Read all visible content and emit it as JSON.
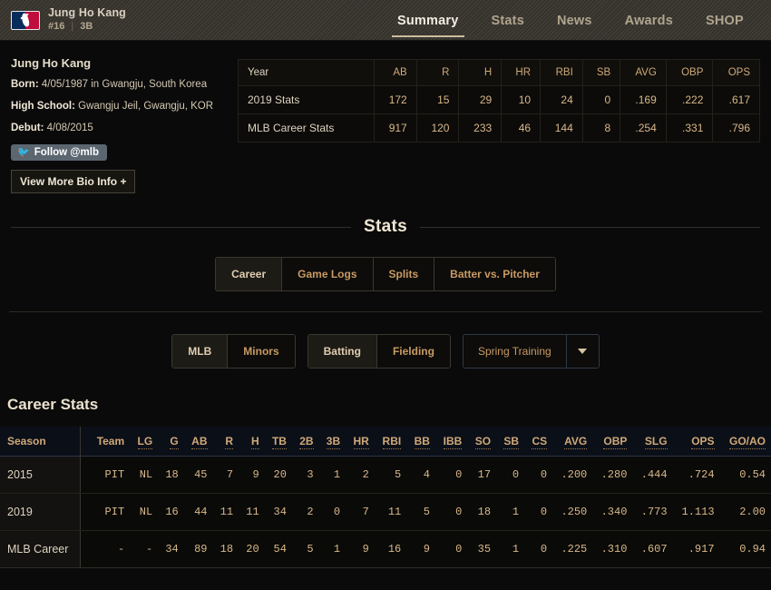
{
  "header": {
    "logo_icon": "mlb-logo-icon",
    "player_name": "Jung Ho Kang",
    "jersey_number": "#16",
    "position": "3B",
    "divider": "|",
    "nav": [
      {
        "label": "Summary",
        "active": true
      },
      {
        "label": "Stats",
        "active": false
      },
      {
        "label": "News",
        "active": false
      },
      {
        "label": "Awards",
        "active": false
      },
      {
        "label": "SHOP",
        "active": false
      }
    ]
  },
  "bio": {
    "name": "Jung Ho Kang",
    "born_label": "Born:",
    "born_value": "4/05/1987 in Gwangju, South Korea",
    "high_school_label": "High School:",
    "high_school_value": "Gwangju Jeil, Gwangju, KOR",
    "debut_label": "Debut:",
    "debut_value": "4/08/2015",
    "follow_label": "Follow @mlb",
    "follow_icon": "twitter-bird-icon",
    "more_bio_label": "View More Bio Info +"
  },
  "summary_table": {
    "columns": [
      "Year",
      "AB",
      "R",
      "H",
      "HR",
      "RBI",
      "SB",
      "AVG",
      "OBP",
      "OPS"
    ],
    "rows": [
      {
        "cells": [
          "2019 Stats",
          "172",
          "15",
          "29",
          "10",
          "24",
          "0",
          ".169",
          ".222",
          ".617"
        ]
      },
      {
        "cells": [
          "MLB Career Stats",
          "917",
          "120",
          "233",
          "46",
          "144",
          "8",
          ".254",
          ".331",
          ".796"
        ]
      }
    ]
  },
  "stats_section": {
    "heading": "Stats",
    "primary_tabs": [
      {
        "label": "Career",
        "active": true
      },
      {
        "label": "Game Logs",
        "active": false
      },
      {
        "label": "Splits",
        "active": false
      },
      {
        "label": "Batter vs. Pitcher",
        "active": false
      }
    ],
    "level_tabs": [
      {
        "label": "MLB",
        "active": true
      },
      {
        "label": "Minors",
        "active": false
      }
    ],
    "type_tabs": [
      {
        "label": "Batting",
        "active": true
      },
      {
        "label": "Fielding",
        "active": false
      }
    ],
    "season_dropdown": {
      "label": "Spring Training",
      "caret_icon": "chevron-down-icon"
    }
  },
  "career_stats": {
    "title": "Career Stats",
    "columns": [
      "Season",
      "Team",
      "LG",
      "G",
      "AB",
      "R",
      "H",
      "TB",
      "2B",
      "3B",
      "HR",
      "RBI",
      "BB",
      "IBB",
      "SO",
      "SB",
      "CS",
      "AVG",
      "OBP",
      "SLG",
      "OPS",
      "GO/AO"
    ],
    "rows": [
      {
        "cells": [
          "2015",
          "PIT",
          "NL",
          "18",
          "45",
          "7",
          "9",
          "20",
          "3",
          "1",
          "2",
          "5",
          "4",
          "0",
          "17",
          "0",
          "0",
          ".200",
          ".280",
          ".444",
          ".724",
          "0.54"
        ]
      },
      {
        "cells": [
          "2019",
          "PIT",
          "NL",
          "16",
          "44",
          "11",
          "11",
          "34",
          "2",
          "0",
          "7",
          "11",
          "5",
          "0",
          "18",
          "1",
          "0",
          ".250",
          ".340",
          ".773",
          "1.113",
          "2.00"
        ]
      },
      {
        "cells": [
          "MLB Career",
          "-",
          "-",
          "34",
          "89",
          "18",
          "20",
          "54",
          "5",
          "1",
          "9",
          "16",
          "9",
          "0",
          "35",
          "1",
          "0",
          ".225",
          ".310",
          ".607",
          ".917",
          "0.94"
        ]
      }
    ]
  },
  "colors": {
    "accent_gold": "#d9b88a",
    "header_bg": "#3a372f",
    "page_bg": "#0a0a0a",
    "nav_active": "#f2ece1"
  }
}
